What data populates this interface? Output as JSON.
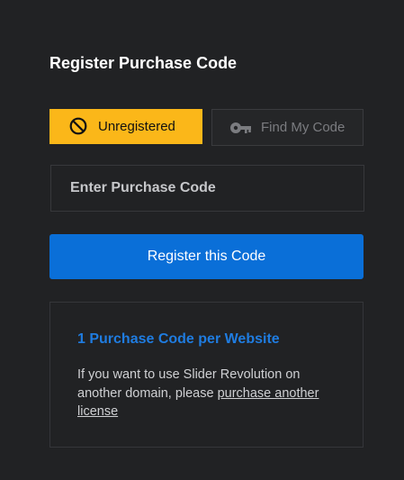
{
  "panel": {
    "title": "Register Purchase Code"
  },
  "status": {
    "badge_label": "Unregistered",
    "badge_icon": "no-entry-icon",
    "badge_color": "#fbb719",
    "find_label": "Find My Code",
    "find_icon": "key-icon"
  },
  "form": {
    "code_placeholder": "Enter Purchase Code",
    "code_value": "",
    "submit_label": "Register this Code",
    "accent_color": "#0a6fd8"
  },
  "info": {
    "title": "1 Purchase Code per Website",
    "text_before_link": "If you want to use Slider Revolution on another domain, please ",
    "link_label": "purchase another license"
  }
}
